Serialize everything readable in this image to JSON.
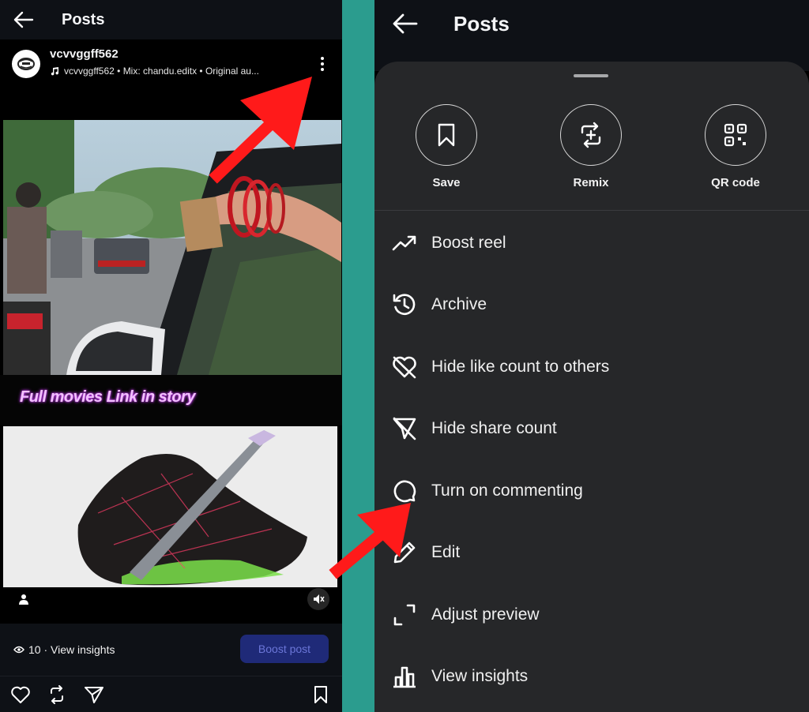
{
  "left": {
    "header": {
      "title": "Posts"
    },
    "post": {
      "username": "vcvvggff562",
      "audio_line": "vcvvggff562 • Mix:  chandu.editx • Original au...",
      "overlay_caption": "Full movies Link in story"
    },
    "insights": {
      "views_text": "10 · View insights",
      "boost_label": "Boost post"
    }
  },
  "right": {
    "header": {
      "title": "Posts"
    },
    "quick_actions": [
      {
        "label": "Save",
        "icon": "bookmark-icon"
      },
      {
        "label": "Remix",
        "icon": "remix-icon"
      },
      {
        "label": "QR code",
        "icon": "qr-code-icon"
      }
    ],
    "menu": [
      {
        "label": "Boost reel",
        "icon": "trend-up-icon"
      },
      {
        "label": "Archive",
        "icon": "archive-history-icon"
      },
      {
        "label": "Hide like count to others",
        "icon": "heart-crossed-icon"
      },
      {
        "label": "Hide share count",
        "icon": "share-crossed-icon"
      },
      {
        "label": "Turn on commenting",
        "icon": "comment-bubble-icon"
      },
      {
        "label": "Edit",
        "icon": "pencil-icon"
      },
      {
        "label": "Adjust preview",
        "icon": "crop-corners-icon"
      },
      {
        "label": "View insights",
        "icon": "bar-chart-icon"
      }
    ]
  },
  "colors": {
    "background_teal": "#2b9c8e",
    "sheet": "#262729",
    "topbar": "#0e1116",
    "boost_button": "#1f2a78",
    "annotation_arrow": "#ff1a1a"
  }
}
